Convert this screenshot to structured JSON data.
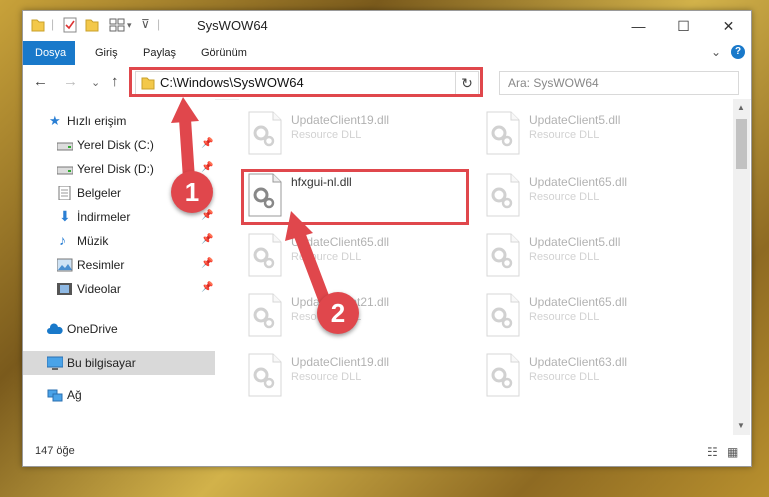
{
  "window": {
    "title": "SysWOW64",
    "controls": {
      "minimize": "—",
      "maximize": "☐",
      "close": "✕"
    }
  },
  "ribbon": {
    "tabs": [
      {
        "label": "Dosya"
      },
      {
        "label": "Giriş"
      },
      {
        "label": "Paylaş"
      },
      {
        "label": "Görünüm"
      }
    ],
    "expand_glyph": "⌄",
    "help_glyph": "?"
  },
  "nav": {
    "back": "←",
    "forward": "→",
    "recent": "⌄",
    "up": "↑",
    "address": "C:\\Windows\\SysWOW64",
    "refresh": "↻",
    "search_placeholder": "Ara: SysWOW64"
  },
  "sidebar": {
    "items": [
      {
        "label": "Hızlı erişim",
        "icon": "star-icon",
        "pinned": false
      },
      {
        "label": "Yerel Disk (C:)",
        "icon": "drive-icon",
        "pinned": true
      },
      {
        "label": "Yerel Disk (D:)",
        "icon": "drive-icon",
        "pinned": true
      },
      {
        "label": "Belgeler",
        "icon": "documents-icon",
        "pinned": true
      },
      {
        "label": "İndirmeler",
        "icon": "download-icon",
        "pinned": true
      },
      {
        "label": "Müzik",
        "icon": "music-icon",
        "pinned": true
      },
      {
        "label": "Resimler",
        "icon": "pictures-icon",
        "pinned": true
      },
      {
        "label": "Videolar",
        "icon": "video-icon",
        "pinned": true
      },
      {
        "label": "OneDrive",
        "icon": "cloud-icon",
        "pinned": false
      },
      {
        "label": "Bu bilgisayar",
        "icon": "computer-icon",
        "pinned": false
      },
      {
        "label": "Ağ",
        "icon": "network-icon",
        "pinned": false
      }
    ],
    "pin_glyph": "📌"
  },
  "files": [
    {
      "name": "UpdateClient19.dll",
      "type": "Resource DLL"
    },
    {
      "name": "UpdateClient5.dll",
      "type": "Resource DLL"
    },
    {
      "name": "hfxgui-nl.dll",
      "type": ""
    },
    {
      "name": "UpdateClient65.dll",
      "type": "Resource DLL"
    },
    {
      "name": "UpdateClient65.dll",
      "type": "Resource DLL"
    },
    {
      "name": "UpdateClient5.dll",
      "type": "Resource DLL"
    },
    {
      "name": "UpdateClient21.dll",
      "type": "Resource DLL"
    },
    {
      "name": "UpdateClient65.dll",
      "type": "Resource DLL"
    },
    {
      "name": "UpdateClient19.dll",
      "type": "Resource DLL"
    },
    {
      "name": "UpdateClient63.dll",
      "type": "Resource DLL"
    }
  ],
  "status": {
    "item_count": "147 öğe"
  },
  "annotations": {
    "step1": "1",
    "step2": "2",
    "color": "#e0474c"
  }
}
